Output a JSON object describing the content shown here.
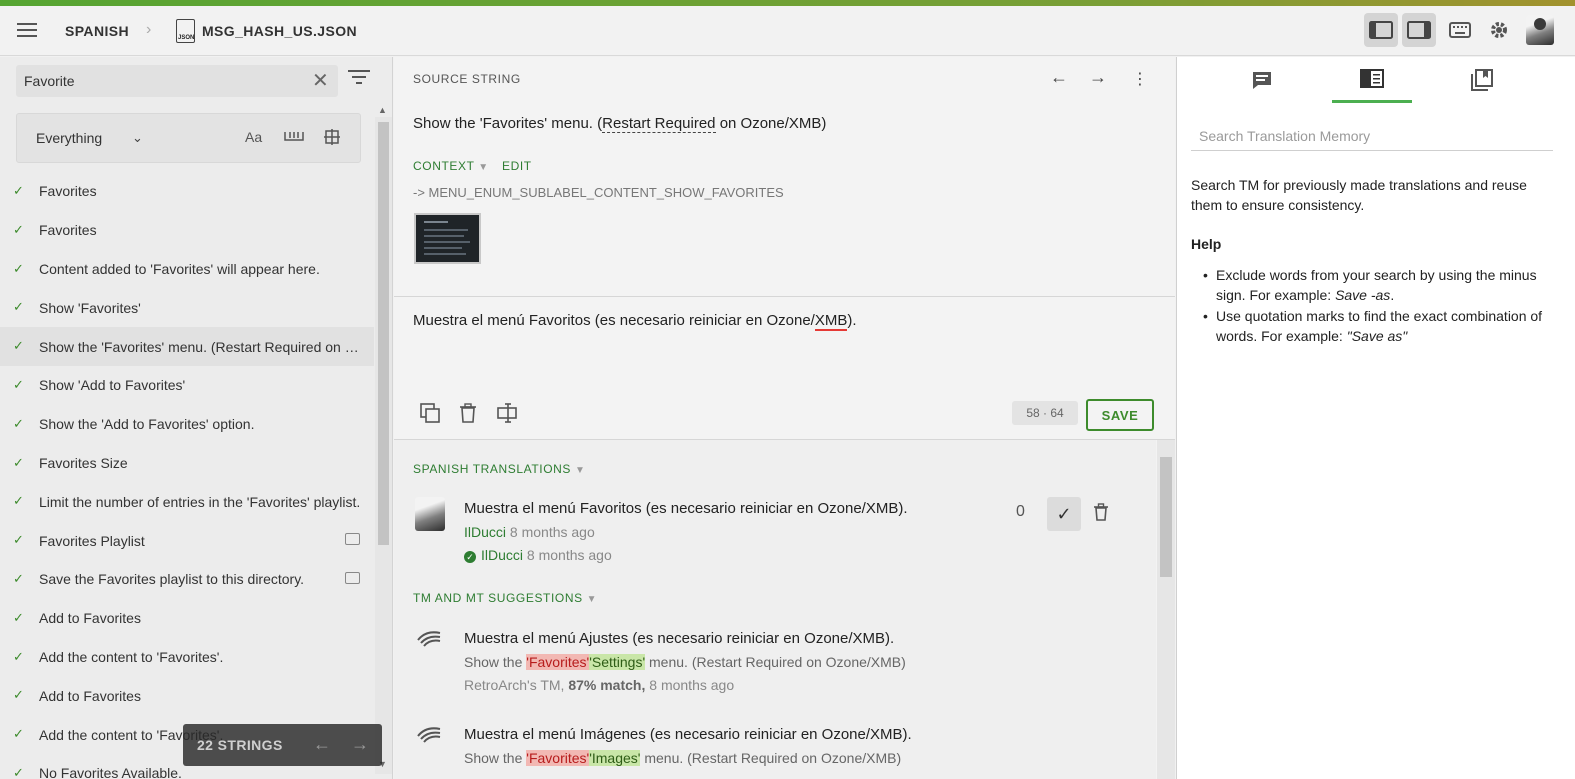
{
  "header": {
    "project": "SPANISH",
    "file": "MSG_HASH_US.JSON",
    "file_badge": "JSON"
  },
  "sidebar": {
    "search_value": "Favorite",
    "filter_scope": "Everything",
    "case_icon": "Aa",
    "items": [
      {
        "text": "Favorites",
        "has_comment": false
      },
      {
        "text": "Favorites",
        "has_comment": false
      },
      {
        "text": "Content added to 'Favorites' will appear here.",
        "has_comment": false
      },
      {
        "text": "Show 'Favorites'",
        "has_comment": false
      },
      {
        "text": "Show the 'Favorites' menu. (Restart Required on Ozone/XMB)",
        "has_comment": false,
        "active": true
      },
      {
        "text": "Show 'Add to Favorites'",
        "has_comment": false
      },
      {
        "text": "Show the 'Add to Favorites' option.",
        "has_comment": false
      },
      {
        "text": "Favorites Size",
        "has_comment": false
      },
      {
        "text": "Limit the number of entries in the 'Favorites' playlist.",
        "has_comment": false
      },
      {
        "text": "Favorites Playlist",
        "has_comment": true
      },
      {
        "text": "Save the Favorites playlist to this directory.",
        "has_comment": true
      },
      {
        "text": "Add to Favorites",
        "has_comment": false
      },
      {
        "text": "Add the content to 'Favorites'.",
        "has_comment": false
      },
      {
        "text": "Add to Favorites",
        "has_comment": false
      },
      {
        "text": "Add the content to 'Favorites'.",
        "has_comment": false
      },
      {
        "text": "No Favorites Available.",
        "has_comment": false
      }
    ],
    "strings_count": "22 STRINGS"
  },
  "source": {
    "header": "SOURCE STRING",
    "text_before": "Show the 'Favorites' menu. (",
    "text_term": "Restart Required",
    "text_after": " on Ozone/XMB)",
    "context_label": "CONTEXT",
    "edit_label": "EDIT",
    "context_key": "-> MENU_ENUM_SUBLABEL_CONTENT_SHOW_FAVORITES"
  },
  "editor": {
    "text_before": "Muestra el menú Favoritos (es necesario reiniciar en Ozone/",
    "text_flagged": "XMB",
    "text_after": ").",
    "char_count": "58 · 64",
    "save_label": "SAVE"
  },
  "translations": {
    "label": "SPANISH TRANSLATIONS",
    "entry": {
      "text": "Muestra el menú Favoritos (es necesario reiniciar en Ozone/XMB).",
      "author": "IlDucci",
      "author_time": "8 months ago",
      "approver": "IlDucci",
      "approver_time": "8 months ago",
      "votes": "0"
    }
  },
  "suggestions": {
    "label": "TM AND MT SUGGESTIONS",
    "items": [
      {
        "text": "Muestra el menú Ajustes (es necesario reiniciar en Ozone/XMB).",
        "src_before": "Show the ",
        "src_deleted": "'Favorites'",
        "src_inserted": "'Settings'",
        "src_after": " menu. (Restart Required on Ozone/XMB)",
        "source_name": "RetroArch's TM,",
        "match": "87% match,",
        "time": "8 months ago"
      },
      {
        "text": "Muestra el menú Imágenes (es necesario reiniciar en Ozone/XMB).",
        "src_before": "Show the ",
        "src_deleted": "'Favorites'",
        "src_inserted": "'Images'",
        "src_after": " menu. (Restart Required on Ozone/XMB)",
        "source_name": "",
        "match": "",
        "time": ""
      }
    ]
  },
  "right_panel": {
    "search_placeholder": "Search Translation Memory",
    "description": "Search TM for previously made translations and reuse them to ensure consistency.",
    "help_title": "Help",
    "help_1_text": "Exclude words from your search by using the minus sign. For example: ",
    "help_1_example": "Save -as",
    "help_1_end": ".",
    "help_2_text": "Use quotation marks to find the exact combination of words. For example: ",
    "help_2_example": "\"Save as\""
  },
  "colors": {
    "accent": "#3d8b2c",
    "tab_active": "#4caf50",
    "error_underline": "#e53935"
  }
}
